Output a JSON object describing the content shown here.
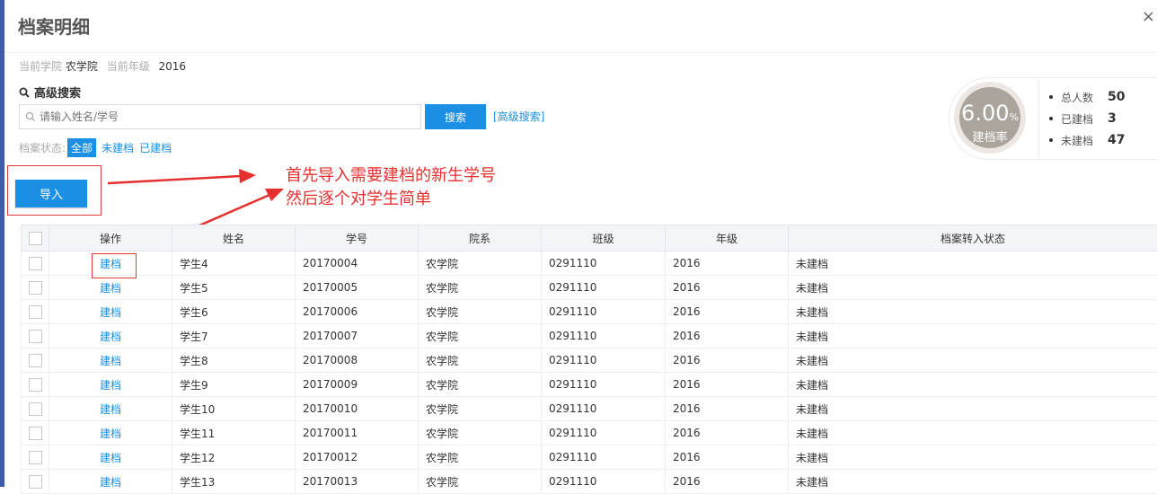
{
  "modal": {
    "title": "档案明细",
    "close_label": "×"
  },
  "info": {
    "college_label": "当前学院",
    "college_value": "农学院",
    "grade_label": "当前年级",
    "grade_value": "2016"
  },
  "search": {
    "title": "高级搜索",
    "placeholder": "请输入姓名/学号",
    "button_label": "搜索",
    "advanced_link": "[高级搜索]"
  },
  "status_filter": {
    "label": "档案状态:",
    "options": [
      "全部",
      "未建档",
      "已建档"
    ],
    "selected": "全部"
  },
  "import_button_label": "导入",
  "annotation": {
    "line1": "首先导入需要建档的新生学号",
    "line2": "然后逐个对学生简单",
    "color": "#e63030"
  },
  "stats": {
    "rate_value": "6.00",
    "rate_unit": "%",
    "rate_label": "建档率",
    "items": [
      {
        "label": "总人数",
        "value": "50"
      },
      {
        "label": "已建档",
        "value": "3"
      },
      {
        "label": "未建档",
        "value": "47"
      }
    ]
  },
  "table": {
    "columns": [
      "操作",
      "姓名",
      "学号",
      "院系",
      "班级",
      "年级",
      "档案转入状态"
    ],
    "rows": [
      {
        "action": "建档",
        "name": "学生4",
        "student_id": "20170004",
        "dept": "农学院",
        "class": "0291110",
        "grade": "2016",
        "status": "未建档"
      },
      {
        "action": "建档",
        "name": "学生5",
        "student_id": "20170005",
        "dept": "农学院",
        "class": "0291110",
        "grade": "2016",
        "status": "未建档"
      },
      {
        "action": "建档",
        "name": "学生6",
        "student_id": "20170006",
        "dept": "农学院",
        "class": "0291110",
        "grade": "2016",
        "status": "未建档"
      },
      {
        "action": "建档",
        "name": "学生7",
        "student_id": "20170007",
        "dept": "农学院",
        "class": "0291110",
        "grade": "2016",
        "status": "未建档"
      },
      {
        "action": "建档",
        "name": "学生8",
        "student_id": "20170008",
        "dept": "农学院",
        "class": "0291110",
        "grade": "2016",
        "status": "未建档"
      },
      {
        "action": "建档",
        "name": "学生9",
        "student_id": "20170009",
        "dept": "农学院",
        "class": "0291110",
        "grade": "2016",
        "status": "未建档"
      },
      {
        "action": "建档",
        "name": "学生10",
        "student_id": "20170010",
        "dept": "农学院",
        "class": "0291110",
        "grade": "2016",
        "status": "未建档"
      },
      {
        "action": "建档",
        "name": "学生11",
        "student_id": "20170011",
        "dept": "农学院",
        "class": "0291110",
        "grade": "2016",
        "status": "未建档"
      },
      {
        "action": "建档",
        "name": "学生12",
        "student_id": "20170012",
        "dept": "农学院",
        "class": "0291110",
        "grade": "2016",
        "status": "未建档"
      },
      {
        "action": "建档",
        "name": "学生13",
        "student_id": "20170013",
        "dept": "农学院",
        "class": "0291110",
        "grade": "2016",
        "status": "未建档"
      }
    ]
  },
  "colors": {
    "primary": "#1a8fe3",
    "annotation_red": "#e63030",
    "rate_circle": "#aaa49d",
    "left_strip": "#3d5ba8"
  }
}
